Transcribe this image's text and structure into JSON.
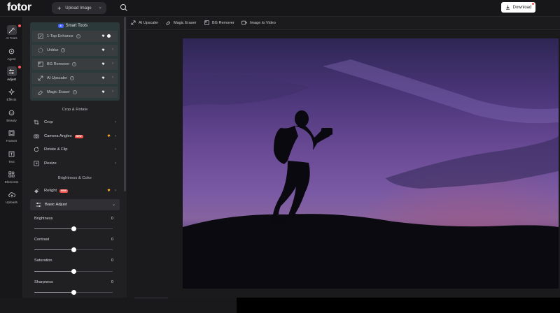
{
  "app": {
    "logo": "fotor"
  },
  "header": {
    "upload_label": "Upload Image",
    "download_label": "Download"
  },
  "rail": {
    "items": [
      {
        "label": "AI Tools",
        "icon": "magic-wand-icon",
        "active": false,
        "badge": true
      },
      {
        "label": "Agent",
        "icon": "agent-icon",
        "active": false,
        "badge": false
      },
      {
        "label": "Adjust",
        "icon": "sliders-icon",
        "active": true,
        "badge": true
      },
      {
        "label": "Effects",
        "icon": "sparkle-icon",
        "active": false,
        "badge": false
      },
      {
        "label": "Beauty",
        "icon": "face-icon",
        "active": false,
        "badge": false
      },
      {
        "label": "Frames",
        "icon": "frame-icon",
        "active": false,
        "badge": false
      },
      {
        "label": "Text",
        "icon": "text-icon",
        "active": false,
        "badge": false
      },
      {
        "label": "Elements",
        "icon": "shapes-icon",
        "active": false,
        "badge": false
      },
      {
        "label": "Uploads",
        "icon": "cloud-upload-icon",
        "active": false,
        "badge": false
      }
    ]
  },
  "subbar": {
    "tools": [
      {
        "label": "AI Upscaler",
        "icon": "upscale-icon"
      },
      {
        "label": "Magic Eraser",
        "icon": "eraser-icon"
      },
      {
        "label": "BG Remover",
        "icon": "bg-remove-icon"
      },
      {
        "label": "Image to Video",
        "icon": "video-icon"
      }
    ]
  },
  "smart_tools": {
    "badge": "AI",
    "title": "Smart Tools",
    "items": [
      {
        "label": "1-Tap Enhance",
        "control": "toggle"
      },
      {
        "label": "Unblur",
        "control": "arrow"
      },
      {
        "label": "BG Remover",
        "control": "arrow"
      },
      {
        "label": "AI Upscaler",
        "control": "arrow"
      },
      {
        "label": "Magic Eraser",
        "control": "arrow"
      }
    ]
  },
  "crop_rotate": {
    "title": "Crop & Rotate",
    "items": [
      {
        "label": "Crop"
      },
      {
        "label": "Camera Angles",
        "new": "NEW"
      },
      {
        "label": "Rotate & Flip"
      },
      {
        "label": "Resize"
      }
    ]
  },
  "brightness_color": {
    "title": "Brightness & Color",
    "relight": {
      "label": "Relight",
      "new": "NEW"
    }
  },
  "basic_adjust": {
    "label": "Basic Adjust",
    "sliders": [
      {
        "label": "Brightness",
        "value": "0",
        "level": 0.5
      },
      {
        "label": "Contrast",
        "value": "0",
        "level": 0.5
      },
      {
        "label": "Saturation",
        "value": "0",
        "level": 0.5
      },
      {
        "label": "Sharpness",
        "value": "0",
        "level": 0.5
      }
    ]
  },
  "colors": {
    "accent_new": "#f0524b",
    "smart_bg": "#2b393b",
    "ai_chip": "#3d5dfd",
    "badge_red": "#ff5a5f"
  }
}
